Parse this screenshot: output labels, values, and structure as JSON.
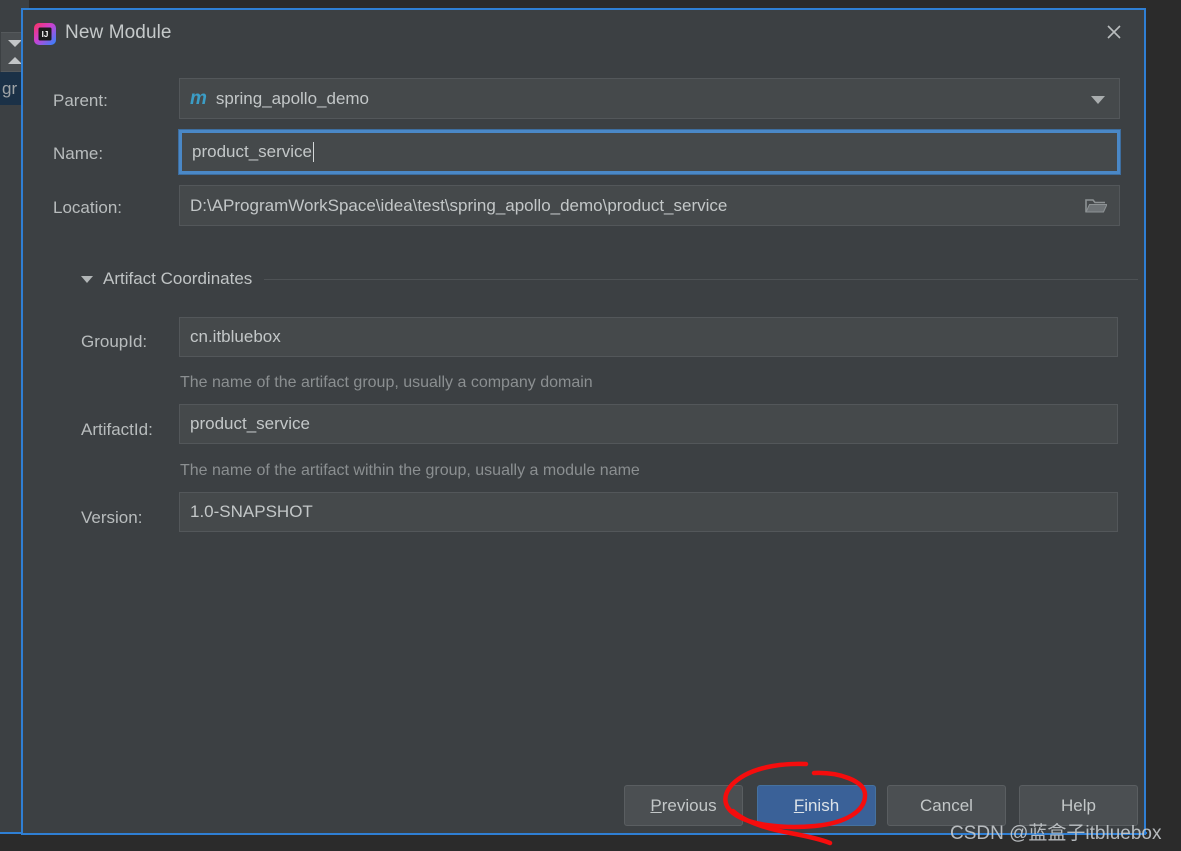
{
  "ide": {
    "left_panel_label": "gr",
    "scroll_down_icon": "triangle-down-icon",
    "scroll_up_icon": "triangle-up-icon"
  },
  "dialog": {
    "title": "New Module",
    "logo_icon": "intellij-idea-logo",
    "close_icon": "close-icon",
    "border_color": "#2f7fd4",
    "background_color": "#3c4043"
  },
  "form": {
    "parent": {
      "label": "Parent:",
      "value": "spring_apollo_demo",
      "icon": "maven-module-icon",
      "dropdown_icon": "chevron-down-icon"
    },
    "name": {
      "label": "Name:",
      "value": "product_service",
      "focused": true
    },
    "location": {
      "label": "Location:",
      "value": "D:\\AProgramWorkSpace\\idea\\test\\spring_apollo_demo\\product_service",
      "browse_icon": "folder-icon"
    }
  },
  "artifact_coordinates": {
    "section_title": "Artifact Coordinates",
    "expanded": true,
    "collapse_icon": "triangle-down-icon",
    "fields": [
      {
        "label": "GroupId:",
        "value": "cn.itbluebox",
        "hint": "The name of the artifact group, usually a company domain"
      },
      {
        "label": "ArtifactId:",
        "value": "product_service",
        "hint": "The name of the artifact within the group, usually a module name"
      },
      {
        "label": "Version:",
        "value": "1.0-SNAPSHOT",
        "hint": ""
      }
    ]
  },
  "buttons": {
    "previous": {
      "label_pre": "",
      "mnemonic": "P",
      "label_post": "revious"
    },
    "finish": {
      "label_pre": "",
      "mnemonic": "F",
      "label_post": "inish",
      "primary": true,
      "color": "#3a6198"
    },
    "cancel": {
      "label": "Cancel"
    },
    "help": {
      "label": "Help"
    }
  },
  "annotation": {
    "shape": "red-ellipse-highlight",
    "color": "#f50d0d",
    "target": "finish-button"
  },
  "watermark": {
    "text": "CSDN @蓝盒子itbluebox"
  }
}
